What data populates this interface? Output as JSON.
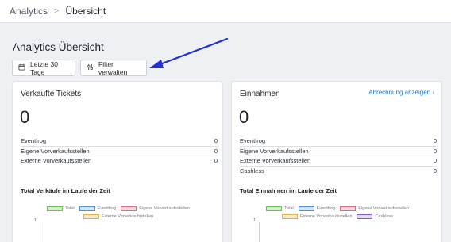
{
  "breadcrumb": {
    "root": "Analytics",
    "separator": ">",
    "current": "Übersicht"
  },
  "page": {
    "title": "Analytics Übersicht"
  },
  "toolbar": {
    "date_button": "Letzte 30 Tage",
    "filter_button": "Filter verwalten"
  },
  "tickets": {
    "title": "Verkaufte Tickets",
    "total": "0",
    "rows": [
      {
        "label": "Eventfrog",
        "value": "0"
      },
      {
        "label": "Eigene Vorverkaufsstellen",
        "value": "0"
      },
      {
        "label": "Externe Vorverkaufsstellen",
        "value": "0"
      }
    ],
    "chart_title": "Total Verkäufe im Laufe der Zeit",
    "legend": [
      {
        "label": "Total",
        "color": "#6bbf59"
      },
      {
        "label": "Eventfrog",
        "color": "#4a90d9"
      },
      {
        "label": "Eigene Vorverkaufsstellen",
        "color": "#e06c7f"
      },
      {
        "label": "Externe Vorverkaufsstellen",
        "color": "#e0b04a"
      }
    ],
    "y_tick": "1"
  },
  "revenue": {
    "title": "Einnahmen",
    "link": "Abrechnung anzeigen",
    "total": "0",
    "rows": [
      {
        "label": "Eventfrog",
        "value": "0"
      },
      {
        "label": "Eigene Vorverkaufsstellen",
        "value": "0"
      },
      {
        "label": "Externe Vorverkaufsstellen",
        "value": "0"
      },
      {
        "label": "Cashless",
        "value": "0"
      }
    ],
    "chart_title": "Total Einnahmen im Laufe der Zeit",
    "legend": [
      {
        "label": "Total",
        "color": "#6bbf59"
      },
      {
        "label": "Eventfrog",
        "color": "#4a90d9"
      },
      {
        "label": "Eigene Vorverkaufsstellen",
        "color": "#e06c7f"
      },
      {
        "label": "Externe Vorverkaufsstellen",
        "color": "#e0b04a"
      },
      {
        "label": "Cashless",
        "color": "#8a5cc7"
      }
    ],
    "y_tick": "1"
  },
  "annotation": {
    "arrow_color": "#1f2fd6"
  },
  "icons": {
    "calendar": "calendar-icon",
    "filter": "filter-sliders-icon",
    "chevron": "chevron-right-icon"
  }
}
